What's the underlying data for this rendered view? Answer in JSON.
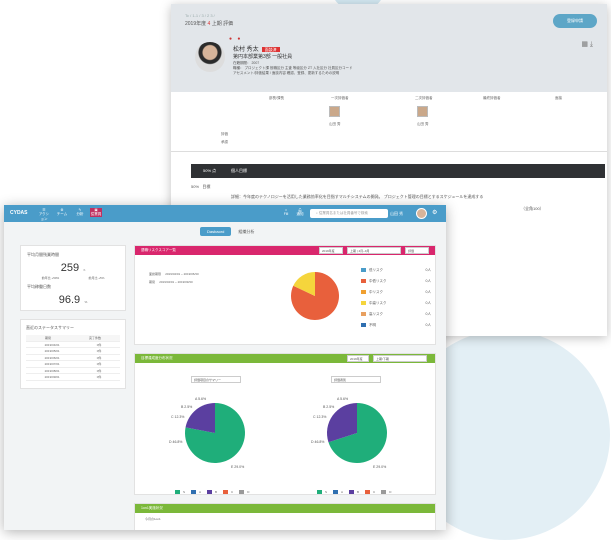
{
  "back": {
    "breadcrumb": "Tc / 1-1  / 3  / 2  3  /   ",
    "period": "2019年度",
    "quarter": "4",
    "term": "上期",
    "eval": "評価",
    "register_btn": "登録申請",
    "person": {
      "name": "松村 秀太",
      "tag": "面談済",
      "dept": "第円本部業第3部 一般社員",
      "info1": "在籍期間：  2007",
      "info2": "職種：  プロジェクト課  役職区分  主査  等級区分  ZT  入社区分  社員区分コード",
      "info3": "アセスメント/評価結果 / 面談内容 確認、登録、更新するための説明"
    },
    "org": {
      "cols": [
        "部長/課長",
        "一次評価者",
        "二次評価者",
        "最終評価者",
        "面接"
      ],
      "row1": "評価",
      "row2": "承認",
      "p1": "山田 秀",
      "p2": "山田 秀"
    },
    "section": {
      "pct": "50% 点",
      "title": "個人目標"
    },
    "rows": [
      {
        "pct": "50%",
        "label": "目標"
      },
      {
        "pct": "",
        "label": "詳細：今年度のテクノロジーを活用した業務効率化を目指すマルチシステムの開発。 プロジェクト管理の目標とするスケジュールを達成する"
      },
      {
        "pct": "",
        "label": "（全角100）"
      }
    ]
  },
  "front": {
    "logo": "CYDAS",
    "nav": [
      "アクション",
      "チーム",
      "分析",
      "従業員"
    ],
    "nav_right": [
      "Fill",
      "通知"
    ],
    "search_placeholder": "従業員名または社員番号で検索",
    "user": "山田 秀",
    "tabs": {
      "active": "Dasbaord",
      "inactive": "組織分析"
    },
    "kpi": {
      "label1": "平均月間残業時間",
      "value1": "259",
      "unit1": "h",
      "sub1a": "前年比 +50%",
      "sub1b": "前月比 +5%",
      "label2": "平均稼働日数",
      "value2": "96.9",
      "unit2": "%"
    },
    "list": {
      "title": "直近のステータスサマリー",
      "headers": [
        "期間",
        "完了件数"
      ],
      "rows": [
        [
          "2019/04/01",
          "0件"
        ],
        [
          "2019/05/01",
          "0件"
        ],
        [
          "2019/06/01",
          "0件"
        ],
        [
          "2019/07/01",
          "0件"
        ],
        [
          "2019/08/01",
          "0件"
        ],
        [
          "2019/09/01",
          "0件"
        ]
      ]
    },
    "panel1": {
      "title": "退職リスクスコア一覧",
      "filters": [
        "2019年度",
        "上期 | 4月~9月",
        "評価"
      ],
      "rows": [
        [
          "面談期限",
          "2019/04/01 ~ 2019/06/30"
        ],
        [
          "期間",
          "2019/04/01 ~ 2019/09/30"
        ]
      ]
    },
    "panel2": {
      "title": "目標達成度分布状況",
      "filters": [
        "2019年度",
        "上期/下期"
      ],
      "dd1": "評価項目のサマリー",
      "dd2": "評価者別"
    },
    "panel3": {
      "title": "1on1実施状況",
      "sub": "今月の1on1",
      "placeholder": "未記入"
    }
  },
  "chart_data": [
    {
      "type": "pie",
      "colors": [
        "#e8603c",
        "#f5d53c"
      ],
      "values": [
        0.82,
        0.18
      ],
      "legend": [
        {
          "label": "低リスク",
          "value": "0人",
          "color": "#4a9cc9"
        },
        {
          "label": "中低リスク",
          "value": "0人",
          "color": "#e8603c"
        },
        {
          "label": "中リスク",
          "value": "0人",
          "color": "#f0a030"
        },
        {
          "label": "中高リスク",
          "value": "0人",
          "color": "#f5d53c"
        },
        {
          "label": "高リスク",
          "value": "0人",
          "color": "#e8a060"
        },
        {
          "label": "不明",
          "value": "0人",
          "color": "#2f6fb0"
        }
      ]
    },
    {
      "type": "pie",
      "colors": [
        "#1fae7a",
        "#5b3fa0"
      ],
      "values": [
        0.78,
        0.22
      ],
      "slice_labels": [
        "A 5.6%",
        "B 2.5%",
        "C 12.3%",
        "D 46.8%",
        "E 29.0%"
      ],
      "legend": [
        "S",
        "A",
        "B",
        "C",
        "D"
      ]
    },
    {
      "type": "pie",
      "colors": [
        "#1fae7a",
        "#5b3fa0"
      ],
      "values": [
        0.7,
        0.3
      ],
      "slice_labels": [
        "A 5.6%",
        "B 2.5%",
        "C 12.3%",
        "D 46.8%",
        "E 29.0%"
      ],
      "legend": [
        "S",
        "A",
        "B",
        "C",
        "D"
      ]
    }
  ]
}
